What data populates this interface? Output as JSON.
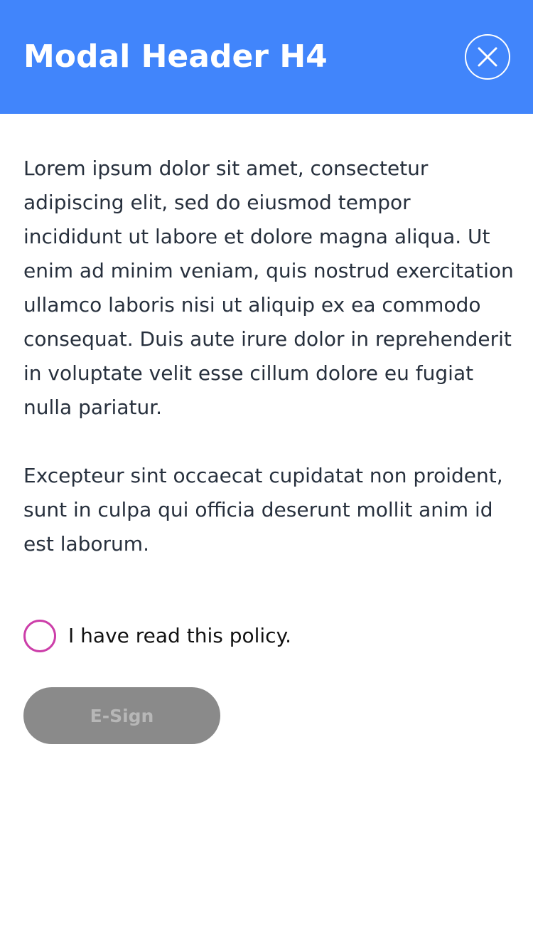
{
  "modal": {
    "title": "Modal Header H4",
    "close_icon": "close-icon",
    "colors": {
      "header_background": "#4185fb",
      "header_text": "#ffffff",
      "body_text": "#27303d",
      "radio_border": "#cc3ea9",
      "button_disabled_background": "#8a8a8a",
      "button_disabled_text": "#b7b7b7"
    },
    "body": {
      "paragraphs": [
        "Lorem ipsum dolor sit amet, consectetur adipiscing elit, sed do eiusmod tempor incididunt ut labore et dolore magna aliqua. Ut enim ad minim veniam, quis nostrud exercitation ullamco laboris nisi ut aliquip ex ea commodo consequat. Duis aute irure dolor in reprehenderit in voluptate velit esse cillum dolore eu fugiat nulla pariatur.",
        "Excepteur sint occaecat cupidatat non proident, sunt in culpa qui officia deserunt mollit anim id est laborum."
      ]
    },
    "policy": {
      "label": "I have read this policy.",
      "checked": false
    },
    "esign": {
      "label": "E-Sign",
      "enabled": false
    }
  }
}
